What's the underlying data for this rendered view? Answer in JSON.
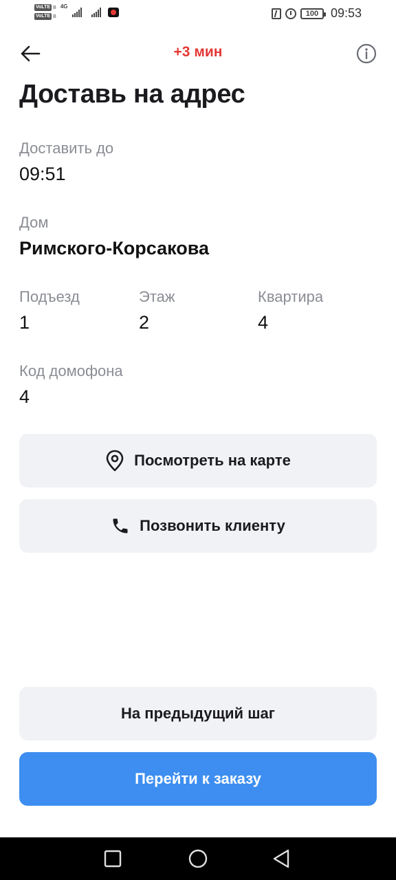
{
  "status_bar": {
    "volte_1": "VoLTE",
    "volte_2": "VoLTE",
    "net_type": "4G",
    "battery": "100",
    "time": "09:53"
  },
  "header": {
    "timer": "+3 мин",
    "title": "Доставь на адрес"
  },
  "delivery": {
    "deadline_label": "Доставить до",
    "deadline_value": "09:51",
    "house_label": "Дом",
    "house_value": "Римского-Корсакова",
    "entrance_label": "Подъезд",
    "entrance_value": "1",
    "floor_label": "Этаж",
    "floor_value": "2",
    "apartment_label": "Квартира",
    "apartment_value": "4",
    "intercom_label": "Код домофона",
    "intercom_value": "4"
  },
  "actions": {
    "map_label": "Посмотреть на карте",
    "call_label": "Позвонить клиенту",
    "prev_label": "На предыдущий шаг",
    "next_label": "Перейти к заказу"
  },
  "icons": {
    "back": "arrow-left-icon",
    "info": "info-icon",
    "map": "map-pin-icon",
    "call": "phone-icon",
    "nav_recents": "square-icon",
    "nav_home": "circle-icon",
    "nav_back": "triangle-back-icon"
  },
  "colors": {
    "accent": "#3d8ef0",
    "timer": "#e53935",
    "label": "#8a8d94",
    "button_bg": "#f1f2f6"
  }
}
